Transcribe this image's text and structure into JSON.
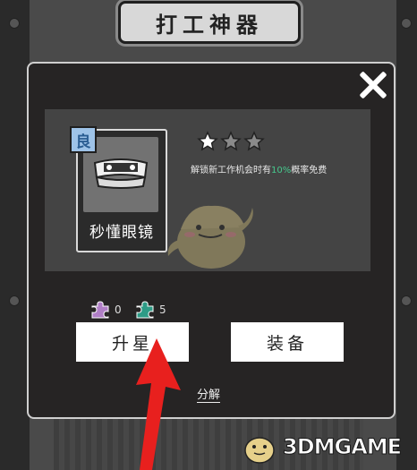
{
  "title": "打工神器",
  "item": {
    "name": "秒懂眼镜",
    "rarity": "良",
    "rarity_color": "#9ec3e8",
    "stars_filled": 1,
    "stars_total": 3,
    "description_before": "解锁新工作机会时有",
    "description_percent": "10%",
    "description_after": "概率免费",
    "highlight_color": "#46c98e"
  },
  "materials": [
    {
      "icon": "purple-puzzle-icon",
      "color": "#b07fc6",
      "count": "0"
    },
    {
      "icon": "teal-puzzle-icon",
      "color": "#2e9b86",
      "count": "5"
    }
  ],
  "buttons": {
    "upgrade": "升星",
    "equip": "装备",
    "decompose": "分解"
  },
  "watermark": "3DMGAME"
}
